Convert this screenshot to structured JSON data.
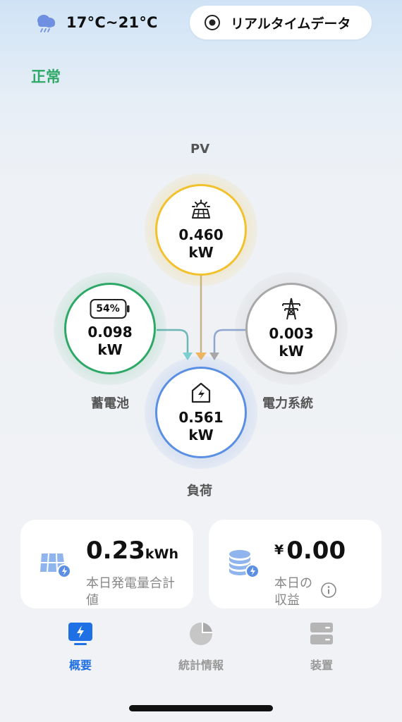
{
  "header": {
    "weather_icon": "cloud-rain-icon",
    "temperature": "17°C~21°C",
    "realtime_button": {
      "icon": "radio-dot-icon",
      "label": "リアルタイムデータ"
    },
    "status": "正常"
  },
  "flow": {
    "pv": {
      "label": "PV",
      "value": "0.460",
      "unit": "kW",
      "icon": "solar-panel-icon"
    },
    "battery": {
      "label": "蓄電池",
      "value": "0.098",
      "unit": "kW",
      "soc": "54%",
      "icon": "battery-icon"
    },
    "grid": {
      "label": "電力系統",
      "value": "0.003",
      "unit": "kW",
      "icon": "power-tower-icon"
    },
    "load": {
      "label": "負荷",
      "value": "0.561",
      "unit": "kW",
      "icon": "home-lightning-icon"
    },
    "colors": {
      "pv": "#f2c12e",
      "battery": "#2ea866",
      "grid": "#9e9e9e",
      "load": "#5b8fe3"
    }
  },
  "cards": {
    "generation": {
      "value": "0.23",
      "unit": "kWh",
      "label": "本日発電量合計値",
      "icon": "solar-panel-bolt-icon"
    },
    "income": {
      "currency": "¥",
      "value": "0.00",
      "label": "本日の収益",
      "icon": "coin-stack-icon"
    }
  },
  "tabbar": [
    {
      "label": "概要",
      "icon": "monitor-bolt-icon",
      "active": true
    },
    {
      "label": "統計情報",
      "icon": "pie-chart-icon",
      "active": false
    },
    {
      "label": "装置",
      "icon": "server-icon",
      "active": false
    }
  ]
}
